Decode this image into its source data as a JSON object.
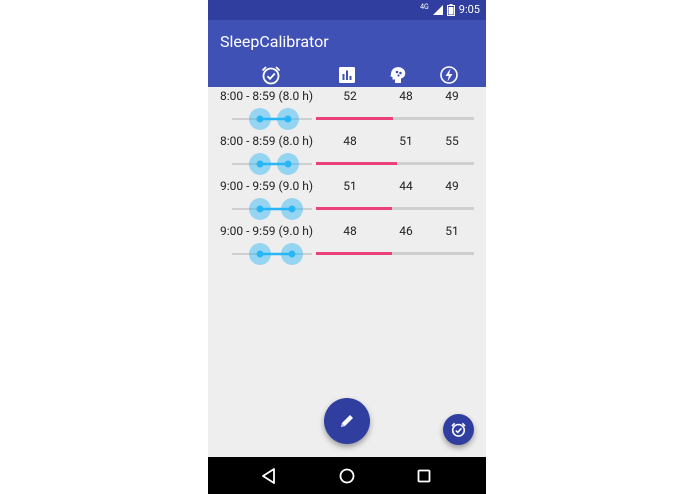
{
  "status_bar": {
    "time": "9:05",
    "network": "4G"
  },
  "app_title": "SleepCalibrator",
  "header_icons": [
    "alarm-clock-icon",
    "bar-chart-icon",
    "brain-icon",
    "lightning-icon"
  ],
  "entries": [
    {
      "range": "8:00 - 8:59 (8.0 h)",
      "values": [
        "52",
        "48",
        "49"
      ],
      "slider": {
        "left": 0.35,
        "right": 0.7
      },
      "quality": 0.49
    },
    {
      "range": "8:00 - 8:59 (8.0 h)",
      "values": [
        "48",
        "51",
        "55"
      ],
      "slider": {
        "left": 0.35,
        "right": 0.7
      },
      "quality": 0.51
    },
    {
      "range": "9:00 - 9:59 (9.0 h)",
      "values": [
        "51",
        "44",
        "49"
      ],
      "slider": {
        "left": 0.35,
        "right": 0.75
      },
      "quality": 0.48
    },
    {
      "range": "9:00 - 9:59 (9.0 h)",
      "values": [
        "48",
        "46",
        "51"
      ],
      "slider": {
        "left": 0.35,
        "right": 0.75
      },
      "quality": 0.48
    }
  ],
  "fab_edit": "pencil-icon",
  "fab_alarm": "alarm-clock-icon",
  "nav": [
    "back-icon",
    "home-icon",
    "recents-icon"
  ],
  "colors": {
    "primary": "#3f51b5",
    "primary_dark": "#303f9f",
    "accent": "#ec407a",
    "slider": "#29b6f6"
  }
}
